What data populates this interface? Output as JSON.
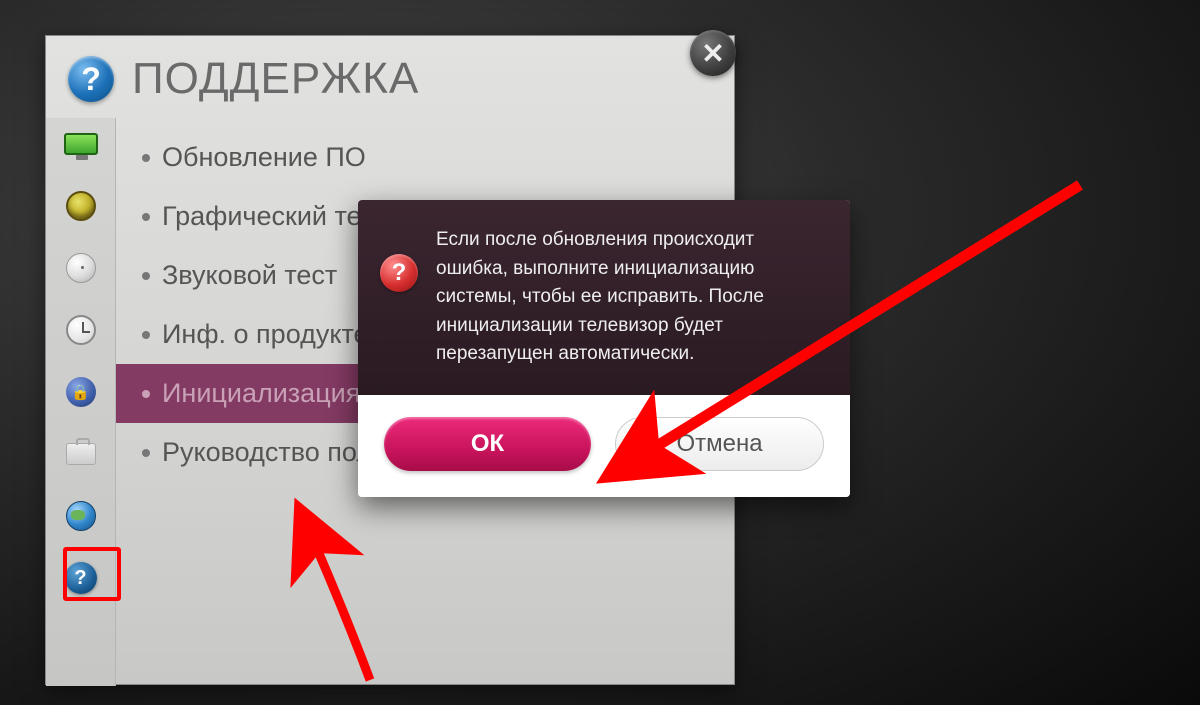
{
  "header": {
    "title": "ПОДДЕРЖКА"
  },
  "sidebar": {
    "icons": [
      "monitor-icon",
      "speaker-icon",
      "satellite-icon",
      "clock-icon",
      "lock-icon",
      "briefcase-icon",
      "globe-icon",
      "help-icon"
    ]
  },
  "menu": {
    "items": [
      {
        "label": "Обновление ПО"
      },
      {
        "label": "Графический тест"
      },
      {
        "label": "Звуковой тест"
      },
      {
        "label": "Инф. о продукте"
      },
      {
        "label": "Инициализация",
        "selected": true
      },
      {
        "label": "Руководство пользователя"
      }
    ]
  },
  "dialog": {
    "message": "Если после обновления происходит ошибка, выполните инициализацию системы, чтобы ее исправить. После инициализации телевизор будет перезапущен автоматически.",
    "ok_label": "ОК",
    "cancel_label": "Отмена"
  },
  "close_glyph": "✕",
  "help_glyph": "?",
  "annotation": {
    "color": "#ff0000"
  }
}
